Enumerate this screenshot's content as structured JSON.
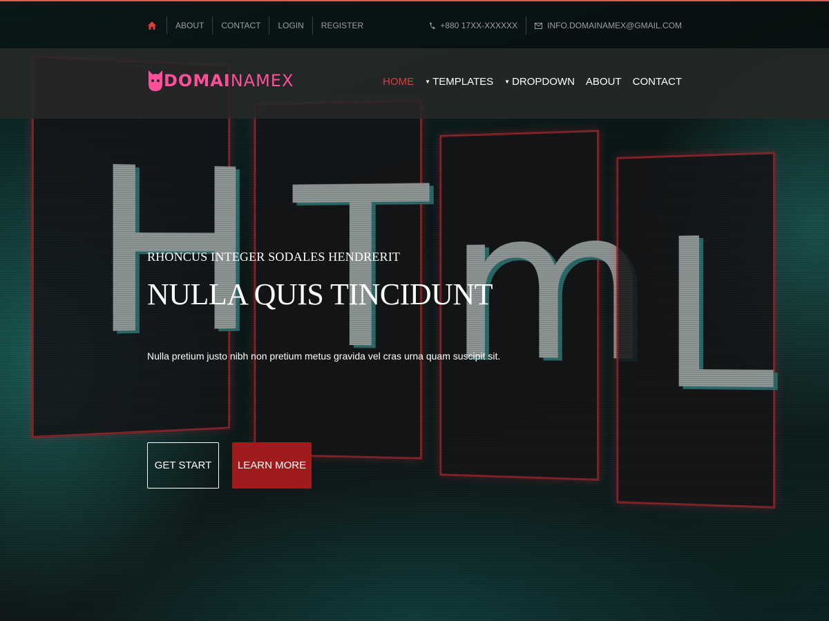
{
  "topbar": {
    "links": [
      "ABOUT",
      "CONTACT",
      "LOGIN",
      "REGISTER"
    ],
    "phone": "+880 17XX-XXXXXX",
    "email": "INFO.DOMAINAMEX@GMAIL.COM"
  },
  "logo": {
    "bold": "DOMAI",
    "thin": "NAMEX"
  },
  "nav": {
    "home": "HOME",
    "templates": "TEMPLATES",
    "dropdown": "DROPDOWN",
    "about": "ABOUT",
    "contact": "CONTACT"
  },
  "background_glyphs": [
    "H",
    "T",
    "m",
    "L"
  ],
  "hero": {
    "subtitle": "RHONCUS INTEGER SODALES HENDRERIT",
    "title": "NULLA QUIS TINCIDUNT",
    "description": "Nulla pretium justo nibh non pretium metus gravida vel cras urna quam suscipit sit.",
    "primary_button": "GET START",
    "secondary_button": "LEARN MORE"
  },
  "colors": {
    "accent_red": "#e23b3b",
    "button_red": "#a01c1c",
    "logo_pink": "#ff4f9a"
  }
}
